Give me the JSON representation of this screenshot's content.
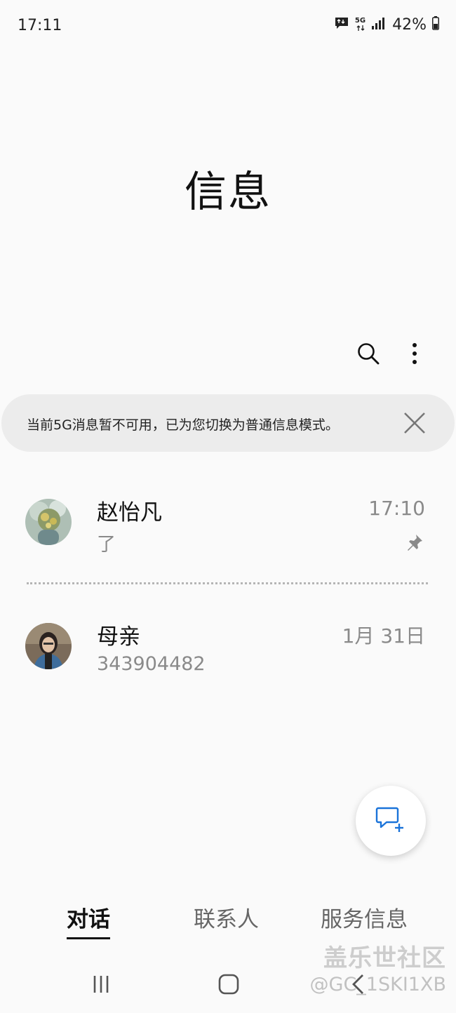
{
  "status_bar": {
    "time": "17:11",
    "network": "5G",
    "battery": "42%",
    "icons": [
      "message-notification-icon",
      "data-arrows-icon",
      "signal-icon",
      "battery-icon"
    ]
  },
  "header": {
    "title": "信息",
    "icons": [
      "search-icon",
      "more-options-icon"
    ]
  },
  "banner": {
    "text": "当前5G消息暂不可用，已为您切换为普通信息模式。",
    "close_icon": "close-icon"
  },
  "conversations": [
    {
      "name": "赵怡凡",
      "preview": "了",
      "time": "17:10",
      "pinned": true
    },
    {
      "name": "母亲",
      "preview": "343904482",
      "time": "1月 31日",
      "pinned": false
    }
  ],
  "fab": {
    "icon": "new-message-icon",
    "accent": "#1a73d9"
  },
  "tabs": [
    {
      "label": "对话",
      "active": true
    },
    {
      "label": "联系人",
      "active": false
    },
    {
      "label": "服务信息",
      "active": false
    }
  ],
  "watermark": {
    "title": "盖乐世社区",
    "handle": "@GC_1SKI1XB"
  },
  "nav_bar": {
    "icons": [
      "recent-apps-icon",
      "home-icon",
      "back-icon"
    ]
  }
}
